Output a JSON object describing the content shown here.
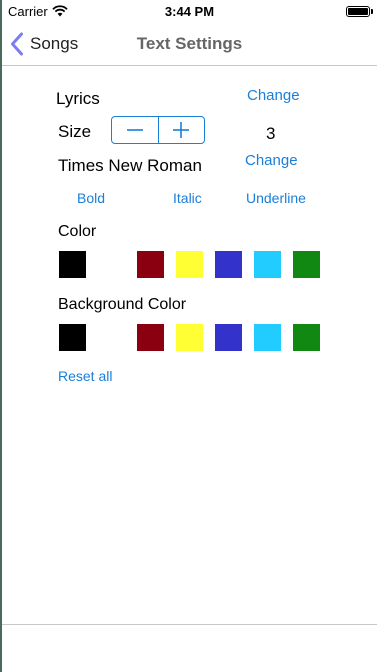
{
  "status_bar": {
    "carrier": "Carrier",
    "time": "3:44 PM"
  },
  "nav": {
    "back_label": "Songs",
    "title": "Text Settings"
  },
  "lyrics": {
    "label": "Lyrics",
    "change_label": "Change"
  },
  "size": {
    "label": "Size",
    "value": "3"
  },
  "font": {
    "name": "Times New Roman",
    "change_label": "Change"
  },
  "styles": {
    "bold": "Bold",
    "italic": "Italic",
    "underline": "Underline"
  },
  "text_color": {
    "label": "Color",
    "swatches": [
      "#000000",
      "#ffffff",
      "#8b0010",
      "#ffff33",
      "#3333cc",
      "#22ccff",
      "#118811"
    ]
  },
  "background_color": {
    "label": "Background Color",
    "swatches": [
      "#000000",
      "#ffffff",
      "#8b0010",
      "#ffff33",
      "#3333cc",
      "#22ccff",
      "#118811"
    ]
  },
  "reset_label": "Reset all",
  "colors": {
    "accent": "#1a7fd9",
    "back_chevron": "#7b7ef0"
  }
}
